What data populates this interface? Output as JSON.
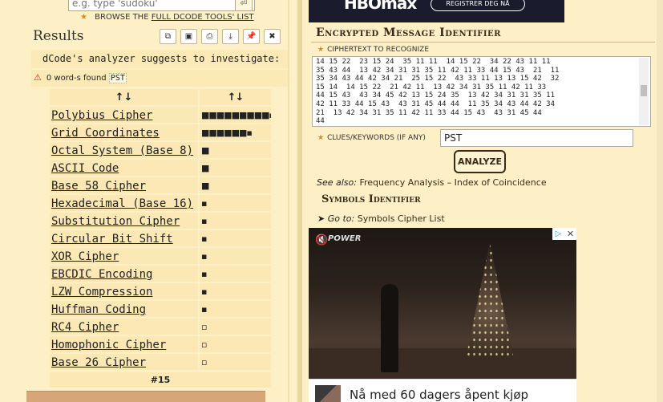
{
  "search": {
    "placeholder": "e.g. type 'sudoku'",
    "button_icon": "enter-icon"
  },
  "browse": {
    "prefix": "BROWSE THE",
    "link": "FULL DCODE TOOLS' LIST"
  },
  "results": {
    "title": "Results",
    "toolbar": [
      "copy-icon",
      "save-icon",
      "print-icon",
      "download-icon",
      "pin-icon",
      "close-icon"
    ],
    "suggest_text": "dCode's analyzer suggests to investigate:",
    "words_found": "0 word-s found",
    "words_tag": "PST",
    "sort_header_1": "↑↓",
    "sort_header_2": "↑↓",
    "rows": [
      {
        "name": "Polybius Cipher",
        "bar": "■■■■■■■■■▪"
      },
      {
        "name": "Grid Coordinates",
        "bar": "■■■■■■▪"
      },
      {
        "name": "Octal System (Base 8)",
        "bar": "■"
      },
      {
        "name": "ASCII Code",
        "bar": "■"
      },
      {
        "name": "Base 58 Cipher",
        "bar": "■"
      },
      {
        "name": "Hexadecimal (Base 16)",
        "bar": "▪"
      },
      {
        "name": "Substitution Cipher",
        "bar": "▪"
      },
      {
        "name": "Circular Bit Shift",
        "bar": "▪"
      },
      {
        "name": "XOR Cipher",
        "bar": "▪"
      },
      {
        "name": "EBCDIC Encoding",
        "bar": "▪"
      },
      {
        "name": "LZW Compression",
        "bar": "▪"
      },
      {
        "name": "Huffman Coding",
        "bar": "▪"
      },
      {
        "name": "RC4 Cipher",
        "bar": "▫"
      },
      {
        "name": "Homophonic Cipher",
        "bar": "▫"
      },
      {
        "name": "Base 26 Cipher",
        "bar": "▫"
      }
    ],
    "footer": "#15"
  },
  "ad_top": {
    "logo": "HBOmax",
    "cta": "REGISTRER DEG NÅ"
  },
  "identifier": {
    "title": "Encrypted Message Identifier",
    "ciphertext_label": "CIPHERTEXT TO RECOGNIZE",
    "ciphertext": "14 15 22  23 15 24  35 11 11  14 15 22  34 22 43 11 11\n35 43 44  13 42 34 31 31 35 11 42 11 33 44 15 43  21  11\n35 34 43 44 42 34 21  25 15 22  43 33 11 13 13 15 42  32\n15 14  14 15 22  21 42 11  13 42 34 31 35 11 42 11 33\n44 15 43  43 34 45 42 13 15 24 35  13 42 34 31 31 35 11\n42 11 33 44 15 43  43 31 45 44 44  11 35 34 43 44 42 34\n21  13 42 34 31 35 11 42 11 33 44 15 43  43 31 45 44\n44",
    "clues_label": "CLUES/KEYWORDS (IF ANY)",
    "clues_value": "PST",
    "analyze_label": "ANALYZE",
    "see_also_prefix": "See also:",
    "see_also_1": "Frequency Analysis",
    "see_also_sep": "–",
    "see_also_2": "Index of Coincidence",
    "symbols_title": "Symbols Identifier",
    "goto_prefix": "➤ Go to:",
    "goto_link": "Symbols Cipher List"
  },
  "video_ad": {
    "logo": "POWER"
  },
  "banner": {
    "text": "Nå med 60 dagers åpent kjøp"
  }
}
